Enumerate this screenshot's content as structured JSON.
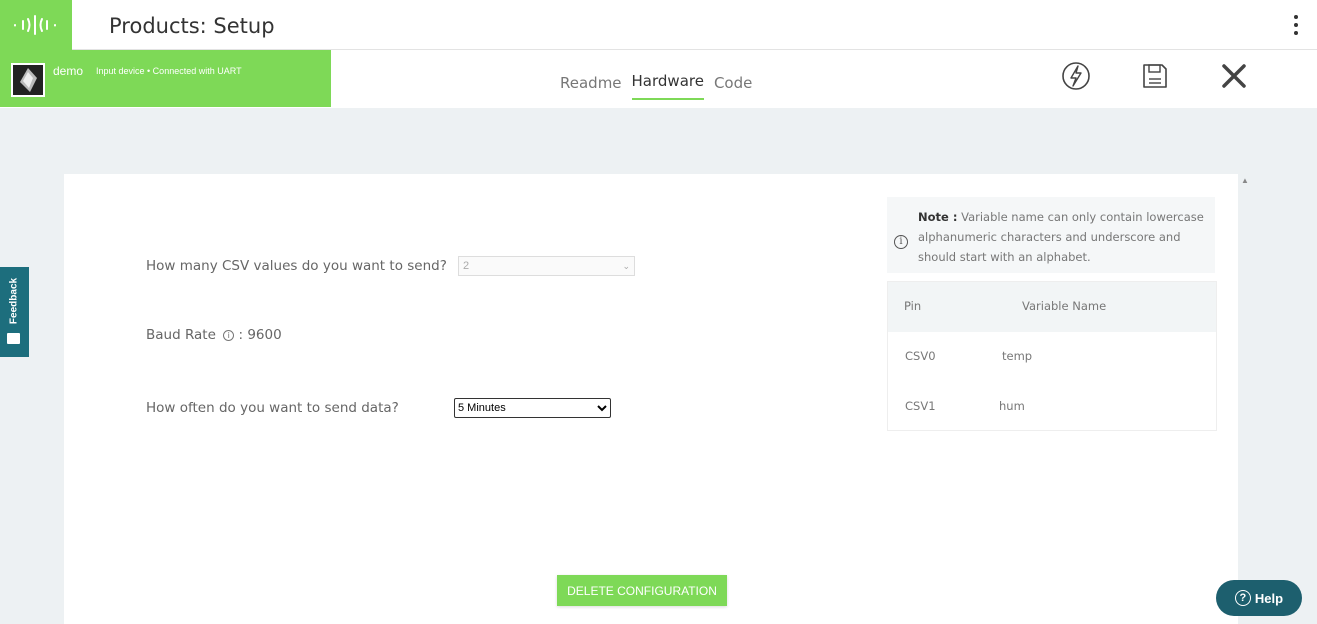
{
  "header": {
    "title": "Products: Setup"
  },
  "device": {
    "name": "demo",
    "status": "Input device • Connected with UART"
  },
  "tabs": [
    {
      "label": "Readme"
    },
    {
      "label": "Hardware"
    },
    {
      "label": "Code"
    }
  ],
  "form": {
    "csv_count_label": "How many CSV values do you want to send?",
    "csv_count_value": "2",
    "baud_rate_label": "Baud Rate",
    "baud_rate_value": ": 9600",
    "interval_label": "How often do you want to send data?",
    "interval_value": "5 Minutes"
  },
  "note": {
    "prefix": "Note :",
    "text": "Variable name can only contain lowercase alphanumeric characters and underscore and should start with an alphabet."
  },
  "table": {
    "headers": [
      "Pin",
      "Variable Name"
    ],
    "rows": [
      {
        "pin": "CSV0",
        "name": "temp"
      },
      {
        "pin": "CSV1",
        "name": "hum"
      }
    ]
  },
  "actions": {
    "delete_label": "DELETE CONFIGURATION"
  },
  "feedback": {
    "label": "Feedback"
  },
  "help": {
    "label": "Help"
  },
  "colors": {
    "accent": "#7ed957",
    "teal": "#1d6e7d"
  }
}
